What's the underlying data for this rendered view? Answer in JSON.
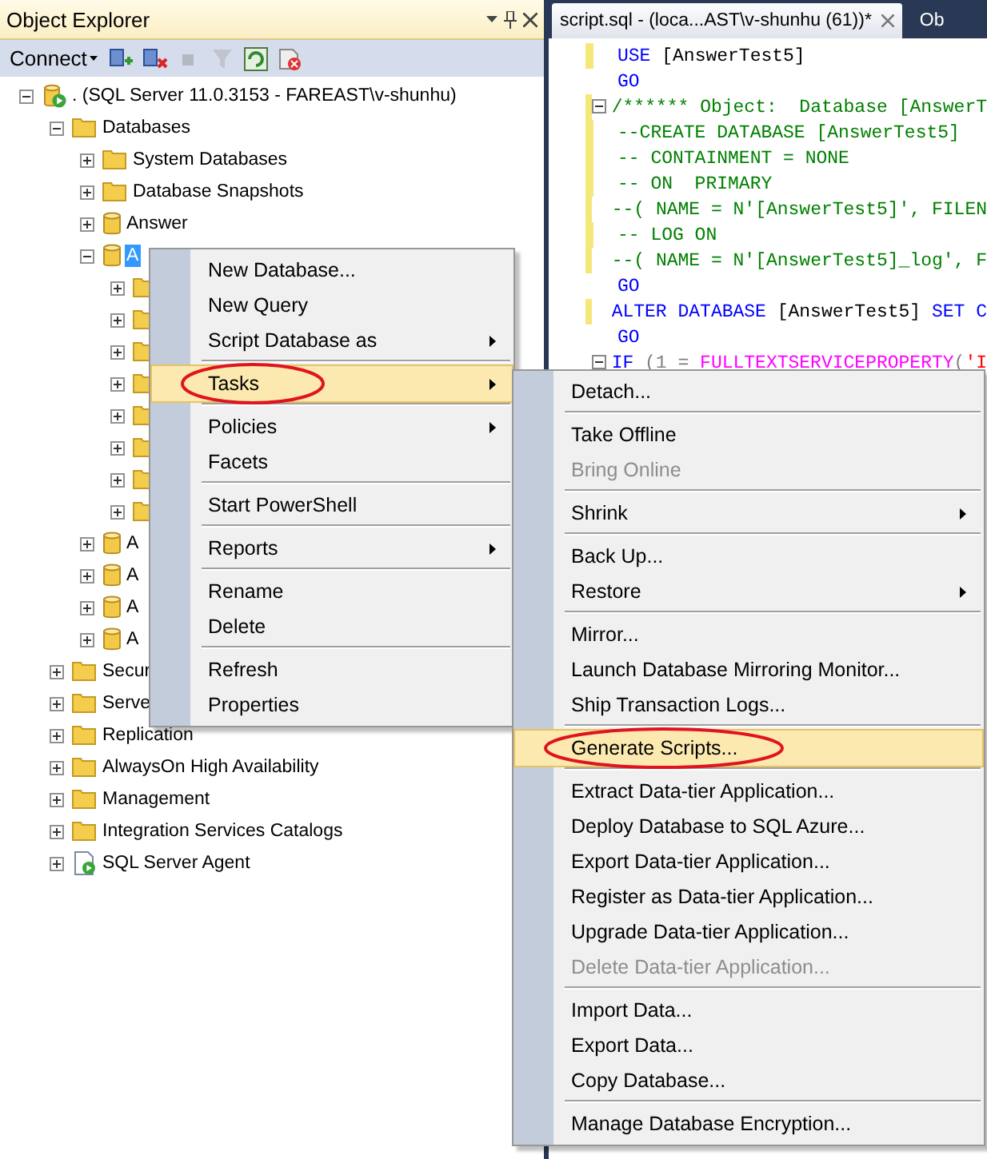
{
  "explorer": {
    "title": "Object Explorer",
    "connect_label": "Connect",
    "toolbar": [
      {
        "kind": "connect",
        "disabled": false
      },
      {
        "kind": "disconnect",
        "disabled": false
      },
      {
        "kind": "stop",
        "disabled": true
      },
      {
        "kind": "filter",
        "disabled": true
      },
      {
        "kind": "refresh",
        "disabled": false
      },
      {
        "kind": "cancel",
        "disabled": false
      }
    ],
    "tree": [
      {
        "kind": "server",
        "label": ". (SQL Server 11.0.3153 - FAREAST\\v-shunhu)",
        "expanded": true,
        "selected": false,
        "children": [
          {
            "kind": "folder",
            "label": "Databases",
            "expanded": true,
            "selected": false,
            "children": [
              {
                "kind": "folder",
                "label": "System Databases",
                "expanded": false,
                "selected": false
              },
              {
                "kind": "folder",
                "label": "Database Snapshots",
                "expanded": false,
                "selected": false
              },
              {
                "kind": "database",
                "label": "Answer",
                "expanded": false,
                "selected": false
              },
              {
                "kind": "database",
                "label": "A",
                "expanded": true,
                "selected": true,
                "children": [
                  {
                    "kind": "folder",
                    "expanded": false
                  },
                  {
                    "kind": "folder",
                    "expanded": false
                  },
                  {
                    "kind": "folder",
                    "expanded": false
                  },
                  {
                    "kind": "folder",
                    "expanded": false
                  },
                  {
                    "kind": "folder",
                    "expanded": false
                  },
                  {
                    "kind": "folder",
                    "expanded": false
                  },
                  {
                    "kind": "folder",
                    "expanded": false
                  },
                  {
                    "kind": "folder",
                    "expanded": false
                  }
                ]
              },
              {
                "kind": "database",
                "label": "A",
                "expanded": false,
                "selected": false
              },
              {
                "kind": "database",
                "label": "A",
                "expanded": false,
                "selected": false
              },
              {
                "kind": "database",
                "label": "A",
                "expanded": false,
                "selected": false
              },
              {
                "kind": "database",
                "label": "A",
                "expanded": false,
                "selected": false
              }
            ]
          },
          {
            "kind": "folder",
            "label": "Secur",
            "expanded": false,
            "selected": false
          },
          {
            "kind": "folder",
            "label": "Serve",
            "expanded": false,
            "selected": false
          },
          {
            "kind": "folder",
            "label": "Replication",
            "expanded": false,
            "selected": false
          },
          {
            "kind": "folder",
            "label": "AlwaysOn High Availability",
            "expanded": false,
            "selected": false
          },
          {
            "kind": "folder",
            "label": "Management",
            "expanded": false,
            "selected": false
          },
          {
            "kind": "folder",
            "label": "Integration Services Catalogs",
            "expanded": false,
            "selected": false
          },
          {
            "kind": "agent",
            "label": "SQL Server Agent",
            "expanded": false,
            "selected": false
          }
        ]
      }
    ]
  },
  "editor": {
    "tabs": [
      {
        "label": "script.sql - (loca...AST\\v-shunhu (61))*",
        "selected": true
      },
      {
        "label": "Ob",
        "selected": false
      }
    ],
    "lines": [
      {
        "modified": true,
        "foldable": false,
        "tokens": [
          {
            "kind": "kw",
            "text": "USE"
          },
          {
            "kind": "id",
            "text": " [AnswerTest5]"
          }
        ]
      },
      {
        "modified": false,
        "foldable": false,
        "tokens": [
          {
            "kind": "kw",
            "text": "GO"
          }
        ]
      },
      {
        "modified": true,
        "foldable": true,
        "tokens": [
          {
            "kind": "cm",
            "text": "/****** Object:  Database [AnswerT"
          }
        ]
      },
      {
        "modified": true,
        "foldable": false,
        "tokens": [
          {
            "kind": "cm",
            "text": "--CREATE DATABASE [AnswerTest5]"
          }
        ]
      },
      {
        "modified": true,
        "foldable": false,
        "tokens": [
          {
            "kind": "cm",
            "text": "-- CONTAINMENT = NONE"
          }
        ]
      },
      {
        "modified": true,
        "foldable": false,
        "tokens": [
          {
            "kind": "cm",
            "text": "-- ON  PRIMARY"
          }
        ]
      },
      {
        "modified": true,
        "foldable": false,
        "tokens": [
          {
            "kind": "cm",
            "text": "--( NAME = N'[AnswerTest5]', FILEN"
          }
        ]
      },
      {
        "modified": true,
        "foldable": false,
        "tokens": [
          {
            "kind": "cm",
            "text": "-- LOG ON"
          }
        ]
      },
      {
        "modified": true,
        "foldable": false,
        "tokens": [
          {
            "kind": "cm",
            "text": "--( NAME = N'[AnswerTest5]_log', F"
          }
        ]
      },
      {
        "modified": false,
        "foldable": false,
        "tokens": [
          {
            "kind": "kw",
            "text": "GO"
          }
        ]
      },
      {
        "modified": true,
        "foldable": false,
        "tokens": [
          {
            "kind": "kw",
            "text": "ALTER DATABASE"
          },
          {
            "kind": "id",
            "text": " [AnswerTest5] "
          },
          {
            "kind": "kw",
            "text": "SET C"
          }
        ]
      },
      {
        "modified": false,
        "foldable": false,
        "tokens": [
          {
            "kind": "kw",
            "text": "GO"
          }
        ]
      },
      {
        "modified": false,
        "foldable": true,
        "tokens": [
          {
            "kind": "kw",
            "text": "IF"
          },
          {
            "kind": "pl",
            "text": " (1 = "
          },
          {
            "kind": "fn",
            "text": "FULLTEXTSERVICEPROPERTY"
          },
          {
            "kind": "pl",
            "text": "("
          },
          {
            "kind": "str",
            "text": "'I"
          }
        ]
      }
    ]
  },
  "context_menu": [
    {
      "kind": "item",
      "label": "New Database...",
      "selected": false,
      "disabled": false,
      "submenu": false,
      "circled": false
    },
    {
      "kind": "item",
      "label": "New Query",
      "selected": false,
      "disabled": false,
      "submenu": false,
      "circled": false
    },
    {
      "kind": "item",
      "label": "Script Database as",
      "selected": false,
      "disabled": false,
      "submenu": true,
      "circled": false
    },
    {
      "kind": "separator"
    },
    {
      "kind": "item",
      "label": "Tasks",
      "selected": true,
      "disabled": false,
      "submenu": true,
      "circled": true
    },
    {
      "kind": "separator"
    },
    {
      "kind": "item",
      "label": "Policies",
      "selected": false,
      "disabled": false,
      "submenu": true,
      "circled": false
    },
    {
      "kind": "item",
      "label": "Facets",
      "selected": false,
      "disabled": false,
      "submenu": false,
      "circled": false
    },
    {
      "kind": "separator"
    },
    {
      "kind": "item",
      "label": "Start PowerShell",
      "selected": false,
      "disabled": false,
      "submenu": false,
      "circled": false
    },
    {
      "kind": "separator"
    },
    {
      "kind": "item",
      "label": "Reports",
      "selected": false,
      "disabled": false,
      "submenu": true,
      "circled": false
    },
    {
      "kind": "separator"
    },
    {
      "kind": "item",
      "label": "Rename",
      "selected": false,
      "disabled": false,
      "submenu": false,
      "circled": false
    },
    {
      "kind": "item",
      "label": "Delete",
      "selected": false,
      "disabled": false,
      "submenu": false,
      "circled": false
    },
    {
      "kind": "separator"
    },
    {
      "kind": "item",
      "label": "Refresh",
      "selected": false,
      "disabled": false,
      "submenu": false,
      "circled": false
    },
    {
      "kind": "item",
      "label": "Properties",
      "selected": false,
      "disabled": false,
      "submenu": false,
      "circled": false
    }
  ],
  "tasks_menu": [
    {
      "kind": "item",
      "label": "Detach...",
      "selected": false,
      "disabled": false,
      "submenu": false,
      "circled": false
    },
    {
      "kind": "separator"
    },
    {
      "kind": "item",
      "label": "Take Offline",
      "selected": false,
      "disabled": false,
      "submenu": false,
      "circled": false
    },
    {
      "kind": "item",
      "label": "Bring Online",
      "selected": false,
      "disabled": true,
      "submenu": false,
      "circled": false
    },
    {
      "kind": "separator"
    },
    {
      "kind": "item",
      "label": "Shrink",
      "selected": false,
      "disabled": false,
      "submenu": true,
      "circled": false
    },
    {
      "kind": "separator"
    },
    {
      "kind": "item",
      "label": "Back Up...",
      "selected": false,
      "disabled": false,
      "submenu": false,
      "circled": false
    },
    {
      "kind": "item",
      "label": "Restore",
      "selected": false,
      "disabled": false,
      "submenu": true,
      "circled": false
    },
    {
      "kind": "separator"
    },
    {
      "kind": "item",
      "label": "Mirror...",
      "selected": false,
      "disabled": false,
      "submenu": false,
      "circled": false
    },
    {
      "kind": "item",
      "label": "Launch Database Mirroring Monitor...",
      "selected": false,
      "disabled": false,
      "submenu": false,
      "circled": false
    },
    {
      "kind": "item",
      "label": "Ship Transaction Logs...",
      "selected": false,
      "disabled": false,
      "submenu": false,
      "circled": false
    },
    {
      "kind": "separator"
    },
    {
      "kind": "item",
      "label": "Generate Scripts...",
      "selected": true,
      "disabled": false,
      "submenu": false,
      "circled": true
    },
    {
      "kind": "separator"
    },
    {
      "kind": "item",
      "label": "Extract Data-tier Application...",
      "selected": false,
      "disabled": false,
      "submenu": false,
      "circled": false
    },
    {
      "kind": "item",
      "label": "Deploy Database to SQL Azure...",
      "selected": false,
      "disabled": false,
      "submenu": false,
      "circled": false
    },
    {
      "kind": "item",
      "label": "Export Data-tier Application...",
      "selected": false,
      "disabled": false,
      "submenu": false,
      "circled": false
    },
    {
      "kind": "item",
      "label": "Register as Data-tier Application...",
      "selected": false,
      "disabled": false,
      "submenu": false,
      "circled": false
    },
    {
      "kind": "item",
      "label": "Upgrade Data-tier Application...",
      "selected": false,
      "disabled": false,
      "submenu": false,
      "circled": false
    },
    {
      "kind": "item",
      "label": "Delete Data-tier Application...",
      "selected": false,
      "disabled": true,
      "submenu": false,
      "circled": false
    },
    {
      "kind": "separator"
    },
    {
      "kind": "item",
      "label": "Import Data...",
      "selected": false,
      "disabled": false,
      "submenu": false,
      "circled": false
    },
    {
      "kind": "item",
      "label": "Export Data...",
      "selected": false,
      "disabled": false,
      "submenu": false,
      "circled": false
    },
    {
      "kind": "item",
      "label": "Copy Database...",
      "selected": false,
      "disabled": false,
      "submenu": false,
      "circled": false
    },
    {
      "kind": "separator"
    },
    {
      "kind": "item",
      "label": "Manage Database Encryption...",
      "selected": false,
      "disabled": false,
      "submenu": false,
      "circled": false
    }
  ]
}
